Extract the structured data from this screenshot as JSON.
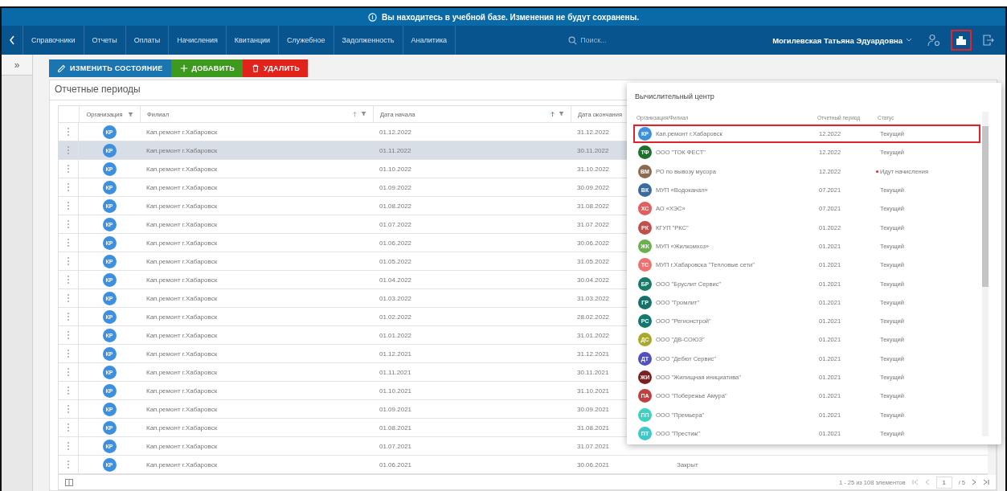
{
  "banner": {
    "text": "Вы находитесь в учебной базе. Изменения не будут сохранены."
  },
  "nav": {
    "items": [
      "Справочники",
      "Отчеты",
      "Оплаты",
      "Начисления",
      "Квитанции",
      "Служебное",
      "Задолженность",
      "Аналитика"
    ],
    "search": {
      "placeholder": "Поиск..."
    },
    "user": "Могилевская Татьяна Эдуардовна",
    "org_button": {
      "highlighted": true
    }
  },
  "sidebar": {
    "toggle": "»"
  },
  "toolbar": [
    {
      "kind": "edit",
      "label": "ИЗМЕНИТЬ СОСТОЯНИЕ"
    },
    {
      "kind": "add",
      "label": "ДОБАВИТЬ"
    },
    {
      "kind": "delete",
      "label": "УДАЛИТЬ"
    }
  ],
  "panel": {
    "title": "Отчетные периоды",
    "columns": [
      "Организация",
      "Филиал",
      "Дата начала",
      "Дата окончания"
    ],
    "rows": [
      {
        "selected": false,
        "initials": "КР",
        "branch": "Кап.ремонт г.Хабаровск",
        "start": "01.12.2022",
        "end": "31.12.2022"
      },
      {
        "selected": true,
        "initials": "КР",
        "branch": "Кап.ремонт г.Хабаровск",
        "start": "01.11.2022",
        "end": "30.11.2022"
      },
      {
        "selected": false,
        "initials": "КР",
        "branch": "Кап.ремонт г.Хабаровск",
        "start": "01.10.2022",
        "end": "31.10.2022"
      },
      {
        "selected": false,
        "initials": "КР",
        "branch": "Кап.ремонт г.Хабаровск",
        "start": "01.09.2022",
        "end": "30.09.2022"
      },
      {
        "selected": false,
        "initials": "КР",
        "branch": "Кап.ремонт г.Хабаровск",
        "start": "01.08.2022",
        "end": "31.08.2022"
      },
      {
        "selected": false,
        "initials": "КР",
        "branch": "Кап.ремонт г.Хабаровск",
        "start": "01.07.2022",
        "end": "31.07.2022"
      },
      {
        "selected": false,
        "initials": "КР",
        "branch": "Кап.ремонт г.Хабаровск",
        "start": "01.06.2022",
        "end": "30.06.2022"
      },
      {
        "selected": false,
        "initials": "КР",
        "branch": "Кап.ремонт г.Хабаровск",
        "start": "01.05.2022",
        "end": "31.05.2022"
      },
      {
        "selected": false,
        "initials": "КР",
        "branch": "Кап.ремонт г.Хабаровск",
        "start": "01.04.2022",
        "end": "30.04.2022"
      },
      {
        "selected": false,
        "initials": "КР",
        "branch": "Кап.ремонт г.Хабаровск",
        "start": "01.03.2022",
        "end": "31.03.2022"
      },
      {
        "selected": false,
        "initials": "КР",
        "branch": "Кап.ремонт г.Хабаровск",
        "start": "01.02.2022",
        "end": "28.02.2022"
      },
      {
        "selected": false,
        "initials": "КР",
        "branch": "Кап.ремонт г.Хабаровск",
        "start": "01.01.2022",
        "end": "31.01.2022"
      },
      {
        "selected": false,
        "initials": "КР",
        "branch": "Кап.ремонт г.Хабаровск",
        "start": "01.12.2021",
        "end": "31.12.2021"
      },
      {
        "selected": false,
        "initials": "КР",
        "branch": "Кап.ремонт г.Хабаровск",
        "start": "01.11.2021",
        "end": "30.11.2021"
      },
      {
        "selected": false,
        "initials": "КР",
        "branch": "Кап.ремонт г.Хабаровск",
        "start": "01.10.2021",
        "end": "31.10.2021"
      },
      {
        "selected": false,
        "initials": "КР",
        "branch": "Кап.ремонт г.Хабаровск",
        "start": "01.09.2021",
        "end": "30.09.2021"
      },
      {
        "selected": false,
        "initials": "КР",
        "branch": "Кап.ремонт г.Хабаровск",
        "start": "01.08.2021",
        "end": "31.08.2021"
      },
      {
        "selected": false,
        "initials": "КР",
        "branch": "Кап.ремонт г.Хабаровск",
        "start": "01.07.2021",
        "end": "31.07.2021"
      },
      {
        "selected": false,
        "initials": "КР",
        "branch": "Кап.ремонт г.Хабаровск",
        "start": "01.06.2021",
        "end": "30.06.2021",
        "column_5": "Закрыт"
      }
    ],
    "pagination": {
      "range": "1 - 25 из 108 элементов",
      "page": "1",
      "pages": "/ 5"
    }
  },
  "org_popup": {
    "title": "Вычислительный центр",
    "columns": [
      "Организация/Филиал",
      "Отчетный период",
      "Статус"
    ],
    "rows": [
      {
        "selected": true,
        "initials": "КР",
        "color": "#3d8fe0",
        "name": "Кап.ремонт г.Хабаровск",
        "period": "12.2022",
        "status": "Текущий",
        "alert": false
      },
      {
        "selected": false,
        "initials": "ТФ",
        "color": "#1f6f2f",
        "name": "ООО \"ТОК ФЕСТ\"",
        "period": "12.2022",
        "status": "Текущий",
        "alert": false
      },
      {
        "selected": false,
        "initials": "ВМ",
        "color": "#8a6a50",
        "name": "РО по вывозу мусора",
        "period": "12.2022",
        "status": "Идут начисления",
        "alert": true
      },
      {
        "selected": false,
        "initials": "ВК",
        "color": "#3a6aa0",
        "name": "МУП «Водоканал»",
        "period": "07.2021",
        "status": "Текущий",
        "alert": false
      },
      {
        "selected": false,
        "initials": "ХС",
        "color": "#e06060",
        "name": "АО «ХЭС»",
        "period": "07.2021",
        "status": "Текущий",
        "alert": false
      },
      {
        "selected": false,
        "initials": "РК",
        "color": "#c0504d",
        "name": "КГУП \"РКС\"",
        "period": "01.2022",
        "status": "Текущий",
        "alert": false
      },
      {
        "selected": false,
        "initials": "ЖК",
        "color": "#6ab04c",
        "name": "МУП «Жилкомхоз»",
        "period": "01.2021",
        "status": "Текущий",
        "alert": false
      },
      {
        "selected": false,
        "initials": "ТС",
        "color": "#f07070",
        "name": "МУП г.Хабаровска \"Тепловые сети\"",
        "period": "01.2021",
        "status": "Текущий",
        "alert": false
      },
      {
        "selected": false,
        "initials": "БР",
        "color": "#1a7a6a",
        "name": "ООО \"Бруслит Сервис\"",
        "period": "01.2021",
        "status": "Текущий",
        "alert": false
      },
      {
        "selected": false,
        "initials": "ГР",
        "color": "#17706a",
        "name": "ООО \"Громлит\"",
        "period": "01.2021",
        "status": "Текущий",
        "alert": false
      },
      {
        "selected": false,
        "initials": "РС",
        "color": "#117a70",
        "name": "ООО \"Регионстрой\"",
        "period": "01.2021",
        "status": "Текущий",
        "alert": false
      },
      {
        "selected": false,
        "initials": "ДС",
        "color": "#a8a82a",
        "name": "ООО \"ДВ-СОЮЗ\"",
        "period": "01.2021",
        "status": "Текущий",
        "alert": false
      },
      {
        "selected": false,
        "initials": "ДТ",
        "color": "#5050c0",
        "name": "ООО \"Дебют Сервис\"",
        "period": "01.2021",
        "status": "Текущий",
        "alert": false
      },
      {
        "selected": false,
        "initials": "ЖИ",
        "color": "#7a2020",
        "name": "ООО \"Жилищная инициатива\"",
        "period": "01.2021",
        "status": "Текущий",
        "alert": false
      },
      {
        "selected": false,
        "initials": "ПА",
        "color": "#c04040",
        "name": "ООО \"Побережье Амура\"",
        "period": "01.2021",
        "status": "Текущий",
        "alert": false
      },
      {
        "selected": false,
        "initials": "ПП",
        "color": "#40d0c0",
        "name": "ООО \"Премьера\"",
        "period": "01.2021",
        "status": "Текущий",
        "alert": false
      },
      {
        "selected": false,
        "initials": "ПТ",
        "color": "#40c8c8",
        "name": "ООО \"Престиж\"",
        "period": "01.2021",
        "status": "Текущий",
        "alert": false
      }
    ]
  }
}
